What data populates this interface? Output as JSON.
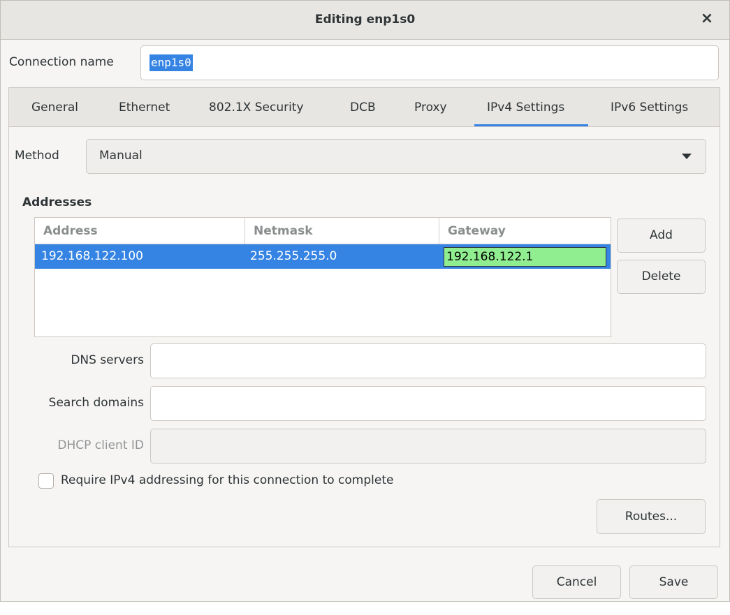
{
  "window": {
    "title": "Editing enp1s0"
  },
  "connection": {
    "label": "Connection name",
    "value": "enp1s0"
  },
  "tabs": [
    {
      "label": "General"
    },
    {
      "label": "Ethernet"
    },
    {
      "label": "802.1X Security"
    },
    {
      "label": "DCB"
    },
    {
      "label": "Proxy"
    },
    {
      "label": "IPv4 Settings",
      "active": true
    },
    {
      "label": "IPv6 Settings"
    }
  ],
  "method": {
    "label": "Method",
    "value": "Manual"
  },
  "addresses": {
    "heading": "Addresses",
    "columns": [
      "Address",
      "Netmask",
      "Gateway"
    ],
    "rows": [
      {
        "address": "192.168.122.100",
        "netmask": "255.255.255.0",
        "gateway": "192.168.122.1"
      }
    ],
    "add_label": "Add",
    "delete_label": "Delete"
  },
  "fields": {
    "dns_label": "DNS servers",
    "dns_value": "",
    "search_label": "Search domains",
    "search_value": "",
    "dhcp_label": "DHCP client ID",
    "dhcp_value": ""
  },
  "require": {
    "label": "Require IPv4 addressing for this connection to complete",
    "checked": false
  },
  "buttons": {
    "routes": "Routes...",
    "cancel": "Cancel",
    "save": "Save"
  },
  "colors": {
    "accent": "#3584e4",
    "edit_cell": "#90ee90"
  }
}
